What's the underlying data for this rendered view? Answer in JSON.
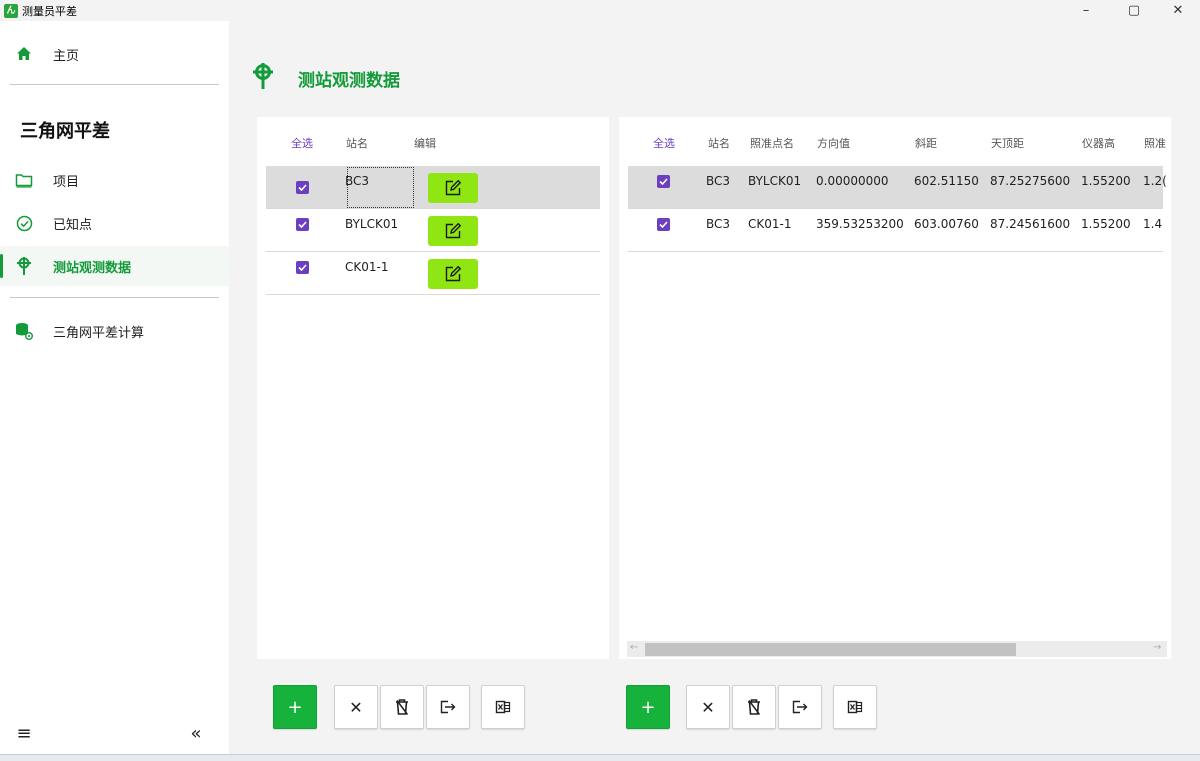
{
  "app": {
    "title": "测量员平差",
    "icon_letter": "ん"
  },
  "window_controls": {
    "minimize": "–",
    "maximize": "▢",
    "close": "✕"
  },
  "sidebar": {
    "home_label": "主页",
    "section_title": "三角网平差",
    "items": [
      {
        "label": "项目",
        "icon": "folder-icon"
      },
      {
        "label": "已知点",
        "icon": "check-circle-icon"
      },
      {
        "label": "测站观测数据",
        "icon": "station-icon",
        "active": true
      }
    ],
    "calc_label": "三角网平差计算",
    "menu_glyph": "≡",
    "collapse_glyph": "«"
  },
  "page": {
    "title": "测站观测数据"
  },
  "stations_table": {
    "headers": {
      "select_all": "全选",
      "name": "站名",
      "edit": "编辑"
    },
    "rows": [
      {
        "name": "BC3",
        "checked": true,
        "selected": true
      },
      {
        "name": "BYLCK01",
        "checked": true,
        "selected": false
      },
      {
        "name": "CK01-1",
        "checked": true,
        "selected": false
      }
    ]
  },
  "observations_table": {
    "headers": {
      "select_all": "全选",
      "station": "站名",
      "target": "照准点名",
      "direction": "方向值",
      "slope_dist": "斜距",
      "zenith": "天顶距",
      "inst_height": "仪器高",
      "target_height": "照准"
    },
    "rows": [
      {
        "station": "BC3",
        "target": "BYLCK01",
        "direction": "0.00000000",
        "slope_dist": "602.51150",
        "zenith": "87.25275600",
        "inst_height": "1.55200",
        "target_height": "1.2(",
        "selected": true
      },
      {
        "station": "BC3",
        "target": "CK01-1",
        "direction": "359.53253200",
        "slope_dist": "603.00760",
        "zenith": "87.24561600",
        "inst_height": "1.55200",
        "target_height": "1.4",
        "selected": false
      }
    ],
    "scroll_left": "←",
    "scroll_right": "→"
  },
  "toolbar": {
    "add": "+",
    "cancel": "✕"
  },
  "colors": {
    "accent": "#139b3a",
    "checkbox": "#6b3fbf",
    "edit_button": "#8fe613",
    "add_button": "#16b23b"
  }
}
